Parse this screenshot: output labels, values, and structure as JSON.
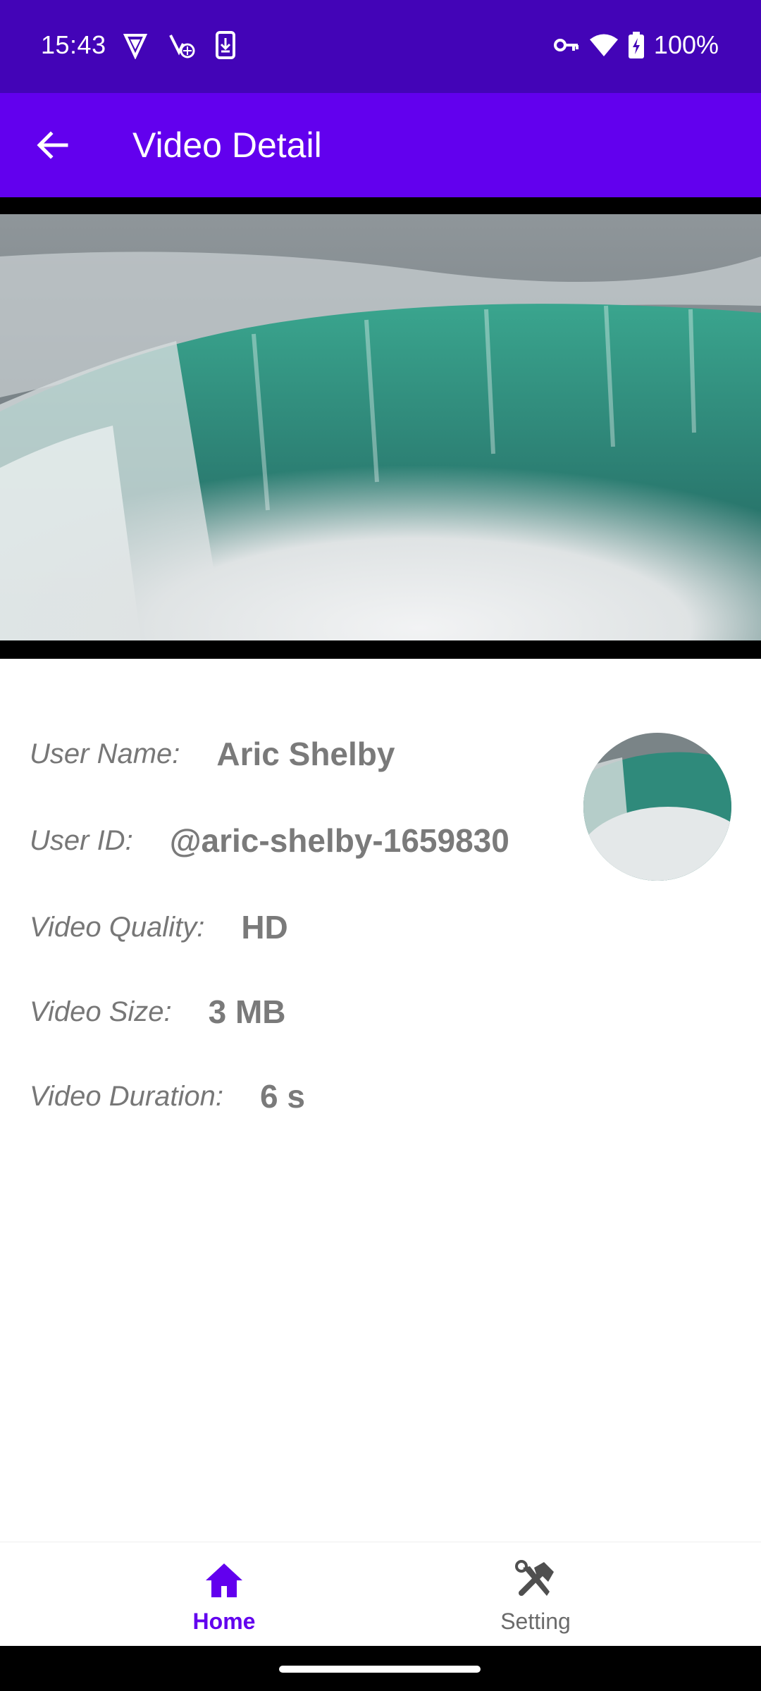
{
  "status_bar": {
    "time": "15:43",
    "battery": "100%",
    "left_icons": [
      "shield-v-icon",
      "vpn-key-ghost-icon",
      "download-phone-icon"
    ],
    "right_icons": [
      "key-icon",
      "wifi-icon",
      "battery-charging-icon"
    ]
  },
  "app_bar": {
    "back_icon": "arrow-back-icon",
    "title": "Video Detail"
  },
  "video": {
    "description_icon": "waterfall-thumbnail"
  },
  "details": {
    "user_name": {
      "label": "User Name:",
      "value": "Aric Shelby"
    },
    "user_id": {
      "label": "User ID:",
      "value": "@aric-shelby-1659830"
    },
    "quality": {
      "label": "Video Quality:",
      "value": "HD"
    },
    "size": {
      "label": "Video Size:",
      "value": "3 MB"
    },
    "duration": {
      "label": "Video Duration:",
      "value": "6 s"
    }
  },
  "bottom_nav": {
    "items": [
      {
        "label": "Home",
        "icon": "home-icon",
        "active": true
      },
      {
        "label": "Setting",
        "icon": "tools-icon",
        "active": false
      }
    ]
  },
  "colors": {
    "status_bar": "#4304b7",
    "app_bar": "#6200ee",
    "active_nav": "#6200ee",
    "detail_text": "#7a7a7a"
  }
}
